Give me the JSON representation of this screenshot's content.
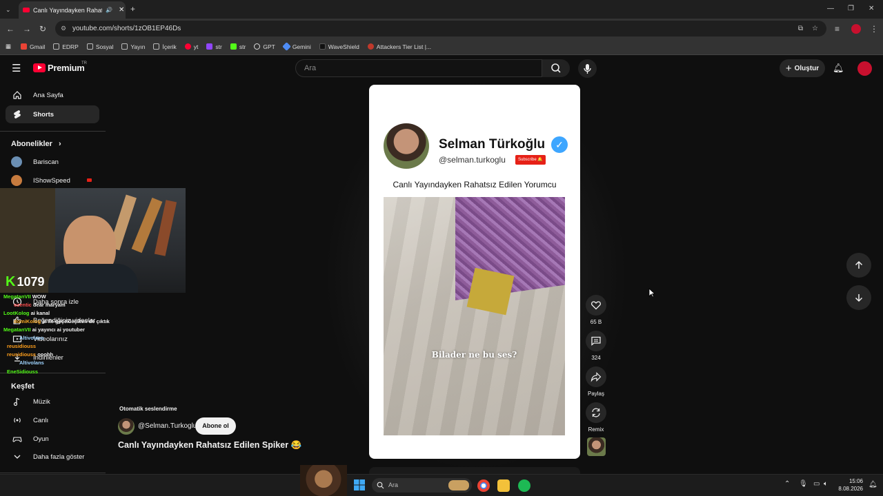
{
  "browser": {
    "tab_title": "Canlı Yayındayken Rahatsız Edilen Spiker",
    "url": "youtube.com/shorts/1zOB1EP46Ds",
    "bookmarks": [
      {
        "label": "Gmail",
        "color": "#ea4335"
      },
      {
        "label": "EDRP",
        "color": "#bbbbbb"
      },
      {
        "label": "Sosyal",
        "color": "#bbbbbb"
      },
      {
        "label": "Yayın",
        "color": "#bbbbbb"
      },
      {
        "label": "İçerik",
        "color": "#bbbbbb"
      },
      {
        "label": "yt",
        "color": "#ff0033"
      },
      {
        "label": "str",
        "color": "#9146ff"
      },
      {
        "label": "str",
        "color": "#53fc18"
      },
      {
        "label": "GPT",
        "color": "#dddddd"
      },
      {
        "label": "Gemini",
        "color": "#4e8cf5"
      },
      {
        "label": "WaveShield",
        "color": "#1a1a1a"
      },
      {
        "label": "Attackers Tier List |...",
        "color": "#c0392b"
      }
    ]
  },
  "header": {
    "logo_text": "Premium",
    "logo_sup": "TR",
    "search_placeholder": "Ara",
    "create_label": "Oluştur"
  },
  "sidebar": {
    "home": "Ana Sayfa",
    "shorts": "Shorts",
    "subscriptions_heading": "Abonelikler",
    "subscriptions": [
      {
        "label": "Bariscan"
      },
      {
        "label": "IShowSpeed"
      }
    ],
    "you_items": [
      {
        "label": "Daha sonra izle"
      },
      {
        "label": "Beğendiğiniz videolar"
      },
      {
        "label": "Videolarınız"
      },
      {
        "label": "İndirilenler"
      }
    ],
    "explore_heading": "Keşfet",
    "explore": [
      {
        "label": "Müzik"
      },
      {
        "label": "Canlı"
      },
      {
        "label": "Oyun"
      },
      {
        "label": "Daha fazla göster"
      }
    ]
  },
  "stream_overlay": {
    "viewer_count": "1079",
    "chat": [
      {
        "user": "MegatanVII",
        "msg": "wow",
        "color": "#53fc18"
      },
      {
        "user": "ozentic",
        "msg": "dear maryam",
        "color": "#ff4d4d"
      },
      {
        "user": "LootKolog",
        "msg": "ai kanal",
        "color": "#53fc18"
      },
      {
        "user": "domiKolog",
        "msg": "ai ile geçekleşiken de çıktık",
        "color": "#f5a623"
      },
      {
        "user": "MegatanVII",
        "msg": "ai yayıncı ai youtuber",
        "color": "#53fc18"
      },
      {
        "user": "Altivolans",
        "msg": "",
        "color": "#9fd4ff"
      },
      {
        "user": "reusidiouss",
        "msg": "",
        "color": "#ff9f1c"
      },
      {
        "user": "reusidiouss",
        "msg": "ooohh",
        "color": "#ff9f1c"
      },
      {
        "user": "Altivolans",
        "msg": "",
        "color": "#9fd4ff"
      },
      {
        "user": "EneSidiouss",
        "msg": "",
        "color": "#53fc18"
      }
    ]
  },
  "short": {
    "creator_name": "Selman Türkoğlu",
    "handle": "@selman.turkoglu",
    "subscribe_badge": "Subscribe 🔔",
    "caption": "Canlı Yayındayken Rahatsız Edilen Yorumcu",
    "video_text": "Bilader ne bu ses?"
  },
  "actions": {
    "likes": "65 B",
    "comments": "324",
    "share": "Paylaş",
    "remix": "Remix"
  },
  "meta": {
    "dubbing_label": "Otomatik seslendirme",
    "channel_handle": "@Selman.Turkoglu",
    "subscribe_label": "Abone ol",
    "title": "Canlı Yayındayken Rahatsız Edilen Spiker 😂"
  },
  "taskbar": {
    "search_placeholder": "Ara",
    "time": "15:06",
    "date": "8.08.2026"
  }
}
